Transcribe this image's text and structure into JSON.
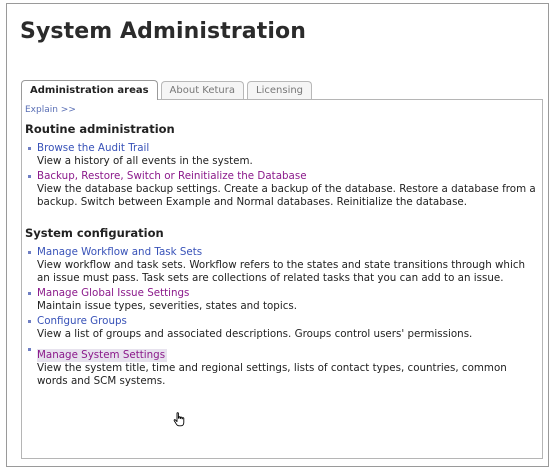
{
  "page": {
    "title": "System Administration"
  },
  "tabs": [
    {
      "label": "Administration areas",
      "active": true
    },
    {
      "label": "About Ketura",
      "active": false
    },
    {
      "label": "Licensing",
      "active": false
    }
  ],
  "explain_link": "Explain >>",
  "sections": [
    {
      "title": "Routine administration",
      "items": [
        {
          "label": "Browse the Audit Trail",
          "description": "View a history of all events in the system."
        },
        {
          "label": "Backup, Restore, Switch or Reinitialize the Database",
          "description": "View the database backup settings. Create a backup of the database. Restore a database from a backup. Switch between Example and Normal databases. Reinitialize the database."
        }
      ]
    },
    {
      "title": "System configuration",
      "items": [
        {
          "label": "Manage Workflow and Task Sets",
          "description": "View workflow and task sets. Workflow refers to the states and state transitions through which an issue must pass. Task sets are collections of related tasks that you can add to an issue."
        },
        {
          "label": "Manage Global Issue Settings",
          "description": "Maintain issue types, severities, states and topics."
        },
        {
          "label": "Configure Groups",
          "description": "View a list of groups and associated descriptions. Groups control users' permissions."
        },
        {
          "label": "Manage System Settings",
          "description": "View the system title, time and regional settings, lists of contact types, countries, common words and SCM systems."
        }
      ]
    }
  ],
  "colors": {
    "link": "#3852b8",
    "visited_link": "#8b1a8b",
    "bullet": "#6f7fc4"
  },
  "cursor_icon": "hand-pointer-icon"
}
